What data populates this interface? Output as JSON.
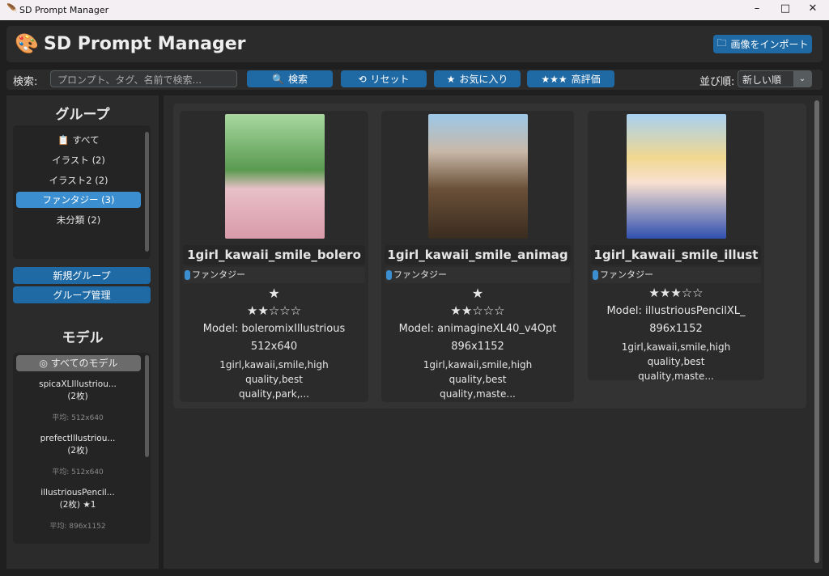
{
  "window": {
    "title": "SD Prompt Manager",
    "minimize": "–",
    "maximize": "□",
    "close": "✕"
  },
  "header": {
    "title": "SD Prompt Manager",
    "logo": "🎨",
    "import_label": "画像をインポート",
    "import_icon": "🗀"
  },
  "toolbar": {
    "search_label": "検索:",
    "search_placeholder": "プロンプト、タグ、名前で検索...",
    "search_btn": "検索",
    "search_icon": "🔍",
    "reset_btn": "リセット",
    "reset_icon": "⟲",
    "fav_btn": "お気に入り",
    "fav_icon": "★",
    "high_btn": "高評価",
    "high_icon": "★★★",
    "sort_label": "並び順:",
    "sort_value": "新しい順",
    "sort_arrow": "⌄"
  },
  "sidebar": {
    "groups_title": "グループ",
    "groups": [
      {
        "label": "📋 すべて"
      },
      {
        "label": "イラスト (2)"
      },
      {
        "label": "イラスト2 (2)"
      },
      {
        "label": "ファンタジー (3)"
      },
      {
        "label": "未分類 (2)"
      }
    ],
    "new_group": "新規グループ",
    "manage_group": "グループ管理",
    "models_title": "モデル",
    "all_models": "◎ すべてのモデル",
    "models": [
      {
        "name": "spicaXLIllustriou...",
        "count": "(2枚)",
        "avg": "平均: 512x640"
      },
      {
        "name": "prefectIllustriou...",
        "count": "(2枚)",
        "avg": "平均: 512x640"
      },
      {
        "name": "illustriousPencil...",
        "count": "(2枚)",
        "fav": "★1",
        "avg": "平均: 896x1152"
      }
    ]
  },
  "cards": [
    {
      "title": "1girl_kawaii_smile_bolero",
      "tag": "ファンタジー",
      "fav": "★",
      "rating": "★★☆☆☆",
      "model": "Model: boleromixIllustrious",
      "size": "512x640",
      "prompt": "1girl,kawaii,smile,high quality,best quality,park,..."
    },
    {
      "title": "1girl_kawaii_smile_animag",
      "tag": "ファンタジー",
      "fav": "★",
      "rating": "★★☆☆☆",
      "model": "Model: animagineXL40_v4Opt",
      "size": "896x1152",
      "prompt": "1girl,kawaii,smile,high quality,best quality,maste..."
    },
    {
      "title": "1girl_kawaii_smile_illust",
      "tag": "ファンタジー",
      "rating": "★★★☆☆",
      "model": "Model: illustriousPencilXL_",
      "size": "896x1152",
      "prompt": "1girl,kawaii,smile,high quality,best quality,maste..."
    }
  ],
  "colors": {
    "accent": "#1f6aa5",
    "selected": "#3b8ed0"
  }
}
